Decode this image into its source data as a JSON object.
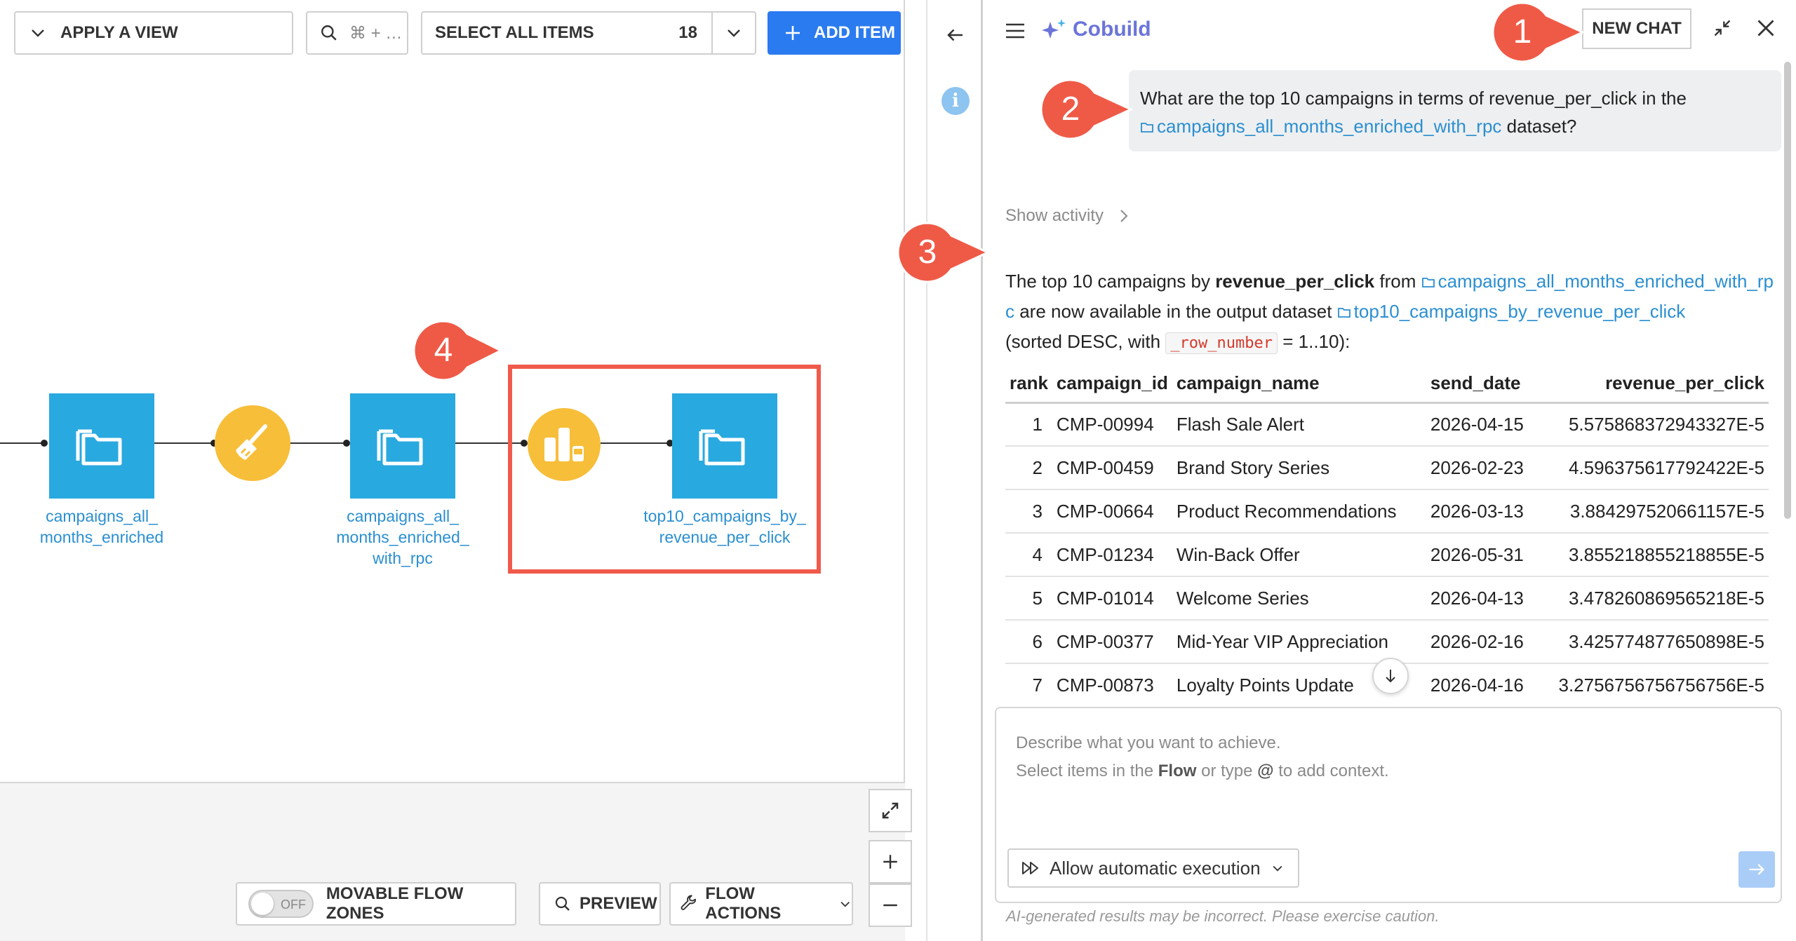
{
  "toolbar": {
    "apply_view_label": "APPLY A VIEW",
    "search_placeholder": "⌘ + …",
    "select_all_label": "SELECT ALL ITEMS",
    "select_all_count": "18",
    "add_item_label": "ADD ITEM"
  },
  "flow": {
    "nodes": [
      {
        "type": "dataset",
        "label": "campaigns_all_ months_enriched"
      },
      {
        "type": "recipe",
        "icon": "broom-icon"
      },
      {
        "type": "dataset",
        "label": "campaigns_all_ months_enriched_ with_rpc"
      },
      {
        "type": "recipe",
        "icon": "topn-icon"
      },
      {
        "type": "dataset",
        "label": "top10_campaigns_by_ revenue_per_click"
      }
    ],
    "highlight_color": "#f05a4a",
    "dataset_color": "#28a9e0",
    "recipe_color": "#f7be39"
  },
  "callouts": {
    "c1": "1",
    "c2": "2",
    "c3": "3",
    "c4": "4",
    "color": "#ef5a47"
  },
  "bottom_bar": {
    "toggle_state": "OFF",
    "movable_label": "MOVABLE FLOW ZONES",
    "preview_label": "PREVIEW",
    "flow_actions_label": "FLOW ACTIONS"
  },
  "chat": {
    "brand": "Cobuild",
    "new_chat_label": "NEW CHAT",
    "user_message": {
      "before": "What are the top 10 campaigns in terms of revenue_per_click in the",
      "dataset_link": "campaigns_all_months_enriched_with_rpc",
      "after": "dataset?"
    },
    "show_activity": "Show activity",
    "answer": {
      "p1": "The top 10 campaigns by ",
      "p1_bold": "revenue_per_click",
      "p1_from": " from ",
      "source_link": "campaigns_all_months_enriched_with_rpc",
      "p2": " are now available in the output dataset ",
      "output_link": "top10_campaigns_by_revenue_per_click",
      "p3": "(sorted DESC, with ",
      "code": "_row_number",
      "p4": " = 1..10):"
    },
    "table": {
      "columns": [
        "rank",
        "campaign_id",
        "campaign_name",
        "send_date",
        "revenue_per_click"
      ],
      "rows": [
        [
          "1",
          "CMP-00994",
          "Flash Sale Alert",
          "2026-04-15",
          "5.575868372943327E-5"
        ],
        [
          "2",
          "CMP-00459",
          "Brand Story Series",
          "2026-02-23",
          "4.596375617792422E-5"
        ],
        [
          "3",
          "CMP-00664",
          "Product Recommendations",
          "2026-03-13",
          "3.884297520661157E-5"
        ],
        [
          "4",
          "CMP-01234",
          "Win-Back Offer",
          "2026-05-31",
          "3.855218855218855E-5"
        ],
        [
          "5",
          "CMP-01014",
          "Welcome Series",
          "2026-04-13",
          "3.478260869565218E-5"
        ],
        [
          "6",
          "CMP-00377",
          "Mid-Year VIP Appreciation",
          "2026-02-16",
          "3.425774877650898E-5"
        ],
        [
          "7",
          "CMP-00873",
          "Loyalty Points Update",
          "2026-04-16",
          "3.2756756756756756E-5"
        ]
      ]
    },
    "composer": {
      "line1": "Describe what you want to achieve.",
      "line2_a": "Select items in the ",
      "line2_b": "Flow",
      "line2_c": " or type ",
      "line2_d": "@",
      "line2_e": " to add context.",
      "auto_exec_label": "Allow automatic execution"
    },
    "disclaimer": "AI-generated results may be incorrect. Please exercise caution."
  }
}
